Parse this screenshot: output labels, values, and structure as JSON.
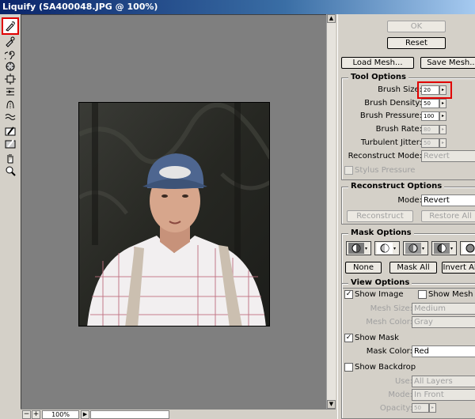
{
  "window": {
    "title": "Liquify (SA400048.JPG @ 100%)"
  },
  "toolbar": {
    "tools": [
      "forward-warp-icon",
      "reconstruct-icon",
      "twirl-icon",
      "pucker-icon",
      "bloat-icon",
      "push-left-icon",
      "mirror-icon",
      "turbulence-icon",
      "freeze-mask-icon",
      "thaw-mask-icon",
      "hand-icon",
      "zoom-icon"
    ]
  },
  "status": {
    "zoom": "100%"
  },
  "buttons": {
    "ok": "OK",
    "reset": "Reset",
    "load_mesh": "Load Mesh...",
    "save_mesh": "Save Mesh..."
  },
  "tool_options": {
    "title": "Tool Options",
    "brush_size_label": "Brush Size:",
    "brush_size": "20",
    "brush_density_label": "Brush Density:",
    "brush_density": "50",
    "brush_pressure_label": "Brush Pressure:",
    "brush_pressure": "100",
    "brush_rate_label": "Brush Rate:",
    "brush_rate": "80",
    "turbulent_jitter_label": "Turbulent Jitter:",
    "turbulent_jitter": "50",
    "reconstruct_mode_label": "Reconstruct Mode:",
    "reconstruct_mode": "Revert",
    "stylus_pressure_label": "Stylus Pressure"
  },
  "reconstruct_options": {
    "title": "Reconstruct Options",
    "mode_label": "Mode:",
    "mode": "Revert",
    "reconstruct_button": "Reconstruct",
    "restore_all_button": "Restore All"
  },
  "mask_options": {
    "title": "Mask Options",
    "none_button": "None",
    "mask_all_button": "Mask All",
    "invert_all_button": "Invert All"
  },
  "view_options": {
    "title": "View Options",
    "show_image_label": "Show Image",
    "show_image": true,
    "show_mesh_label": "Show Mesh",
    "show_mesh": false,
    "mesh_size_label": "Mesh Size:",
    "mesh_size": "Medium",
    "mesh_color_label": "Mesh Color:",
    "mesh_color": "Gray",
    "show_mask_label": "Show Mask",
    "show_mask": true,
    "mask_color_label": "Mask Color:",
    "mask_color": "Red",
    "show_backdrop_label": "Show Backdrop",
    "show_backdrop": false,
    "use_label": "Use:",
    "use": "All Layers",
    "mode_label": "Mode:",
    "mode": "In Front",
    "opacity_label": "Opacity:",
    "opacity": "50"
  }
}
